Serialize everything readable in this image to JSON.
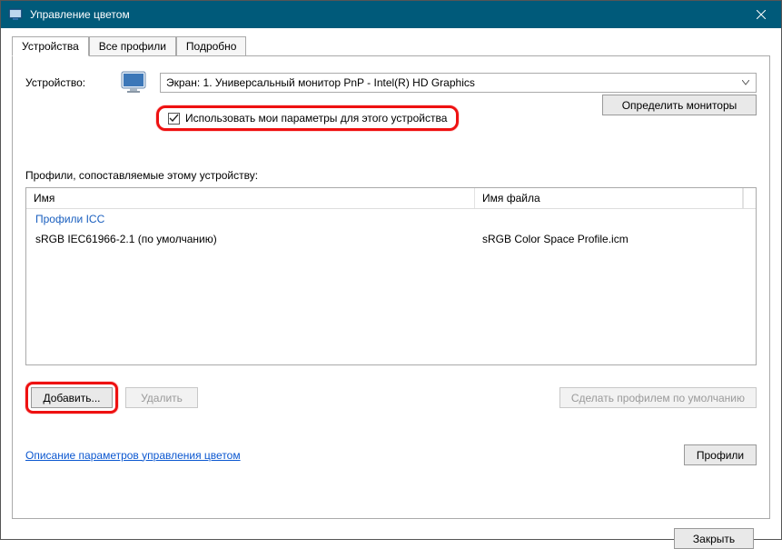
{
  "window": {
    "title": "Управление цветом"
  },
  "tabs": {
    "devices": "Устройства",
    "all_profiles": "Все профили",
    "advanced": "Подробно"
  },
  "panel": {
    "device_label": "Устройство:",
    "device_selected": "Экран: 1. Универсальный монитор PnP - Intel(R) HD Graphics",
    "use_my_settings_label": "Использовать мои параметры для этого устройства",
    "use_my_settings_checked": true,
    "identify_button": "Определить мониторы",
    "profiles_heading": "Профили, сопоставляемые этому устройству:",
    "col_name": "Имя",
    "col_file": "Имя файла",
    "group_label": "Профили ICC",
    "rows": [
      {
        "name": "sRGB IEC61966-2.1 (по умолчанию)",
        "file": "sRGB Color Space Profile.icm"
      }
    ],
    "add_button": "Добавить...",
    "remove_button": "Удалить",
    "set_default_button": "Сделать профилем по умолчанию",
    "help_link": "Описание параметров управления цветом",
    "profiles_button": "Профили"
  },
  "footer": {
    "close_button": "Закрыть"
  }
}
